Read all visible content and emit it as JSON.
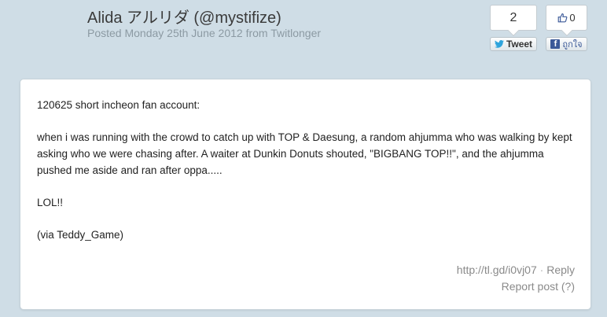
{
  "header": {
    "author": "Alida アルリダ (@mystifize)",
    "meta": "Posted Monday 25th June 2012 from Twitlonger"
  },
  "share": {
    "tweet_count": "2",
    "tweet_label": "Tweet",
    "like_count": "0",
    "fb_label": "ถูกใจ"
  },
  "post": {
    "paragraphs": [
      "120625 short incheon fan account:",
      "when i was running with the crowd to catch up with TOP & Daesung, a random ahjumma who was walking by kept asking who we were chasing after. A waiter at Dunkin Donuts shouted, \"BIGBANG TOP!!\", and the ahjumma pushed me aside and ran after oppa.....",
      "LOL!!",
      "(via Teddy_Game)"
    ]
  },
  "footer": {
    "short_link": "http://tl.gd/i0vj07",
    "separator": "·",
    "reply": "Reply",
    "report": "Report post (?)"
  },
  "colors": {
    "background": "#cfdde6",
    "twitter_blue": "#2fa4dc",
    "facebook_blue": "#3b5998"
  }
}
